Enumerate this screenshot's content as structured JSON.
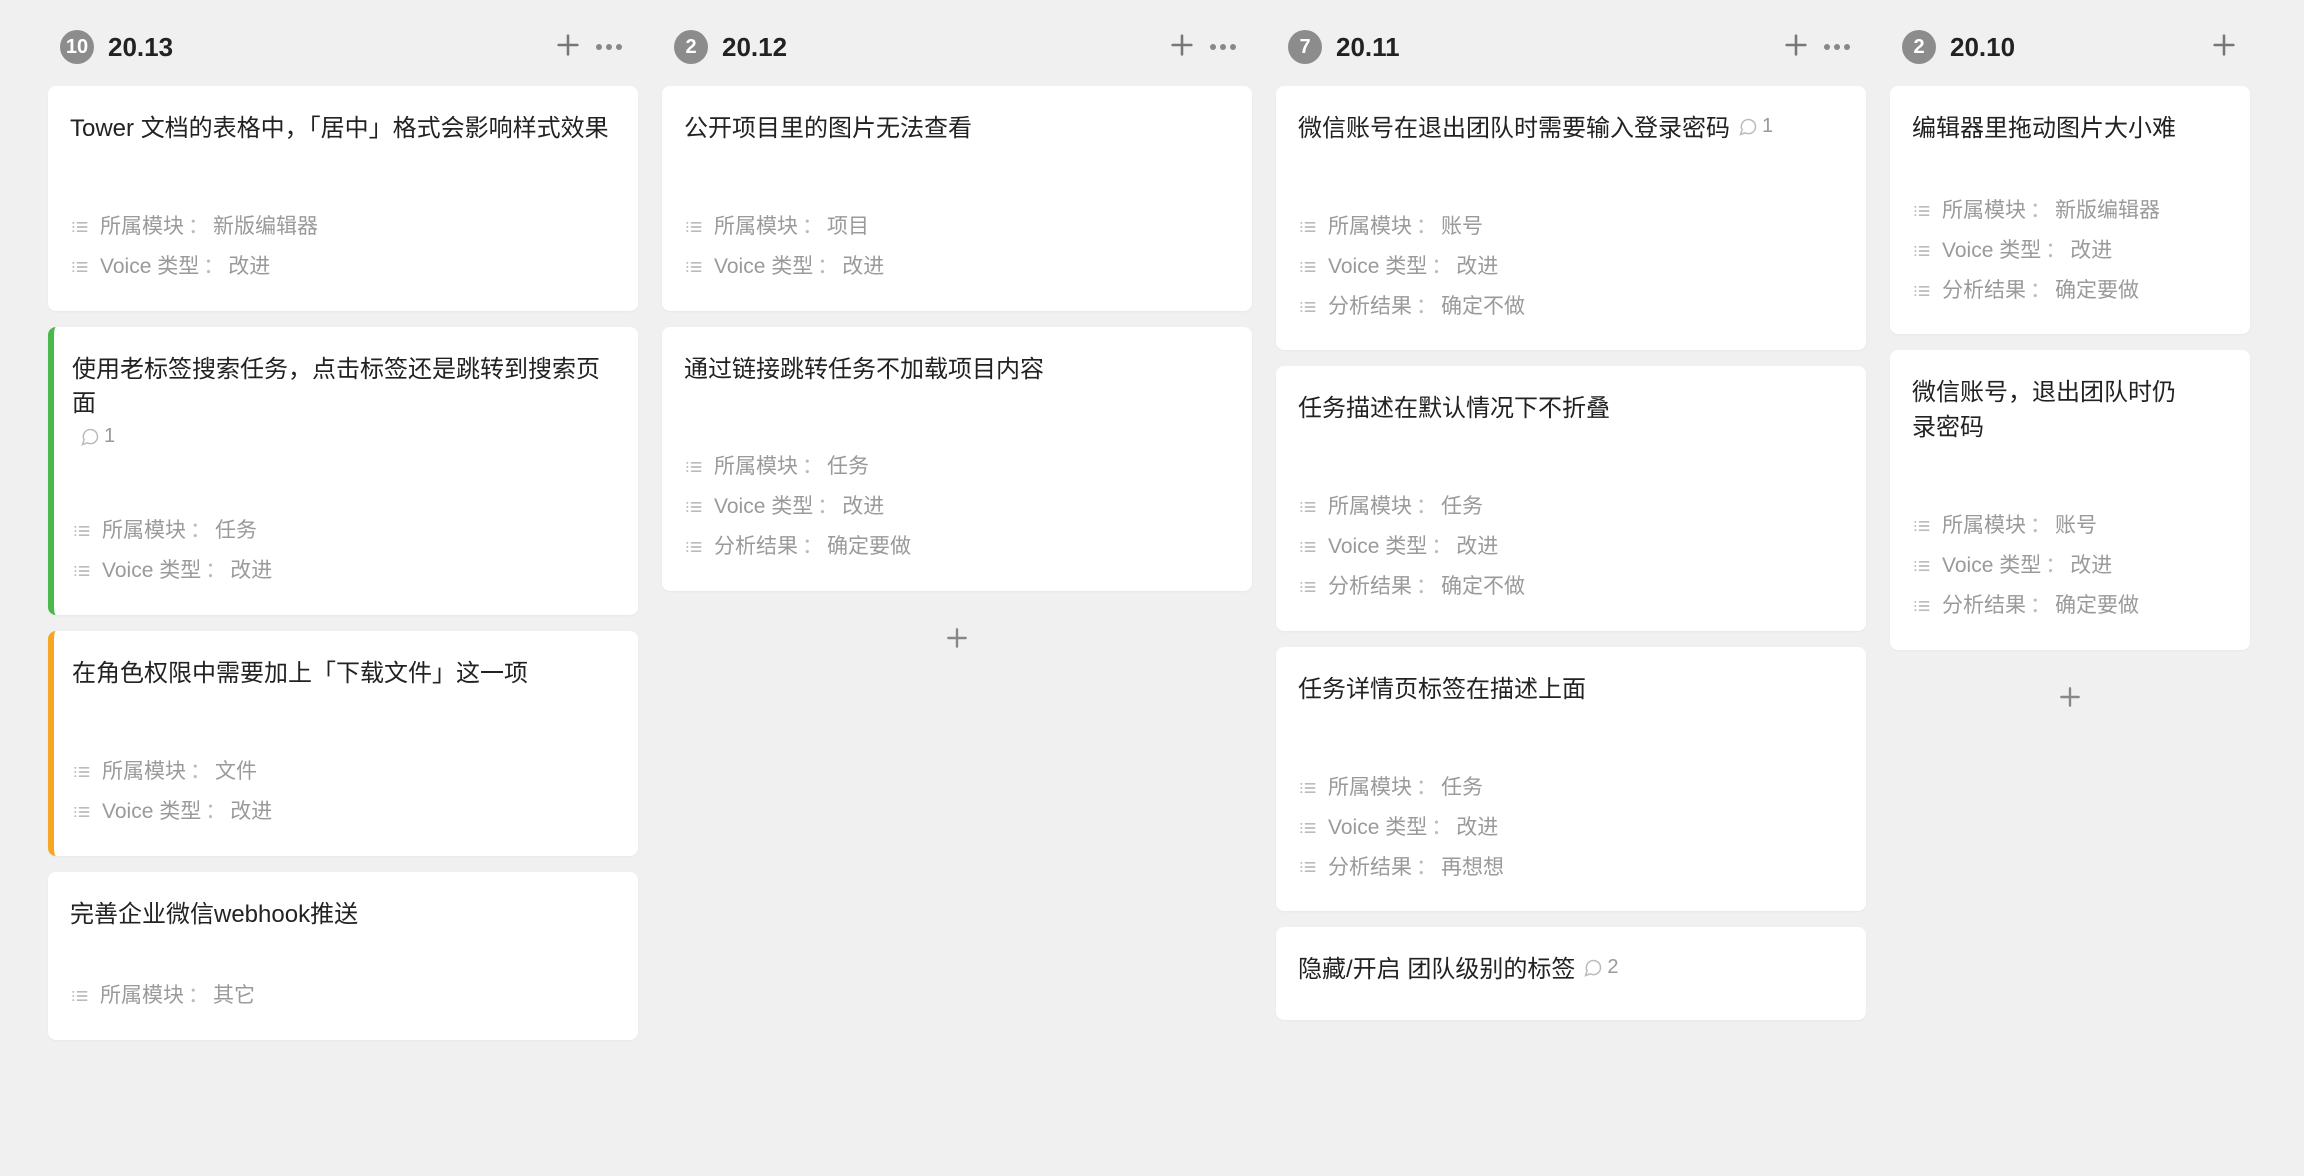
{
  "field_labels": {
    "module": "所属模块",
    "voice_type": "Voice 类型",
    "analysis": "分析结果"
  },
  "columns": [
    {
      "count": "10",
      "title": "20.13",
      "show_more": true,
      "cards": [
        {
          "title": "Tower 文档的表格中，「居中」格式会影响样式效果",
          "stripe": null,
          "fields": [
            {
              "label": "module",
              "value": "新版编辑器"
            },
            {
              "label": "voice_type",
              "value": "改进"
            }
          ]
        },
        {
          "title": "使用老标签搜索任务，点击标签还是跳转到搜索页面",
          "comments": "1",
          "stripe": "green",
          "fields": [
            {
              "label": "module",
              "value": "任务"
            },
            {
              "label": "voice_type",
              "value": "改进"
            }
          ]
        },
        {
          "title": "在角色权限中需要加上「下载文件」这一项",
          "stripe": "orange",
          "fields": [
            {
              "label": "module",
              "value": "文件"
            },
            {
              "label": "voice_type",
              "value": "改进"
            }
          ]
        },
        {
          "title": "完善企业微信webhook推送",
          "stripe": null,
          "tight": true,
          "fields": [
            {
              "label": "module",
              "value": "其它"
            }
          ]
        }
      ],
      "show_add": false
    },
    {
      "count": "2",
      "title": "20.12",
      "show_more": true,
      "cards": [
        {
          "title": "公开项目里的图片无法查看",
          "stripe": null,
          "fields": [
            {
              "label": "module",
              "value": "项目"
            },
            {
              "label": "voice_type",
              "value": "改进"
            }
          ]
        },
        {
          "title": "通过链接跳转任务不加载项目内容",
          "stripe": null,
          "fields": [
            {
              "label": "module",
              "value": "任务"
            },
            {
              "label": "voice_type",
              "value": "改进"
            },
            {
              "label": "analysis",
              "value": "确定要做"
            }
          ]
        }
      ],
      "show_add": true
    },
    {
      "count": "7",
      "title": "20.11",
      "show_more": true,
      "cards": [
        {
          "title": "微信账号在退出团队时需要输入登录密码",
          "comments": "1",
          "stripe": null,
          "fields": [
            {
              "label": "module",
              "value": "账号"
            },
            {
              "label": "voice_type",
              "value": "改进"
            },
            {
              "label": "analysis",
              "value": "确定不做"
            }
          ]
        },
        {
          "title": "任务描述在默认情况下不折叠",
          "stripe": null,
          "fields": [
            {
              "label": "module",
              "value": "任务"
            },
            {
              "label": "voice_type",
              "value": "改进"
            },
            {
              "label": "analysis",
              "value": "确定不做"
            }
          ]
        },
        {
          "title": "任务详情页标签在描述上面",
          "stripe": null,
          "fields": [
            {
              "label": "module",
              "value": "任务"
            },
            {
              "label": "voice_type",
              "value": "改进"
            },
            {
              "label": "analysis",
              "value": "再想想"
            }
          ]
        },
        {
          "title": "隐藏/开启 团队级别的标签",
          "comments": "2",
          "stripe": null,
          "no_fields_yet": true,
          "fields": []
        }
      ],
      "show_add": false
    },
    {
      "count": "2",
      "title": "20.10",
      "show_more": false,
      "truncated": true,
      "cards": [
        {
          "title": "编辑器里拖动图片大小难",
          "stripe": null,
          "tight": true,
          "fields": [
            {
              "label": "module",
              "value": "新版编辑器"
            },
            {
              "label": "voice_type",
              "value": "改进"
            },
            {
              "label": "analysis",
              "value": "确定要做"
            }
          ]
        },
        {
          "title": "微信账号，退出团队时仍",
          "title_line2": "录密码",
          "stripe": null,
          "fields": [
            {
              "label": "module",
              "value": "账号"
            },
            {
              "label": "voice_type",
              "value": "改进"
            },
            {
              "label": "analysis",
              "value": "确定要做"
            }
          ]
        }
      ],
      "show_add": true
    }
  ]
}
